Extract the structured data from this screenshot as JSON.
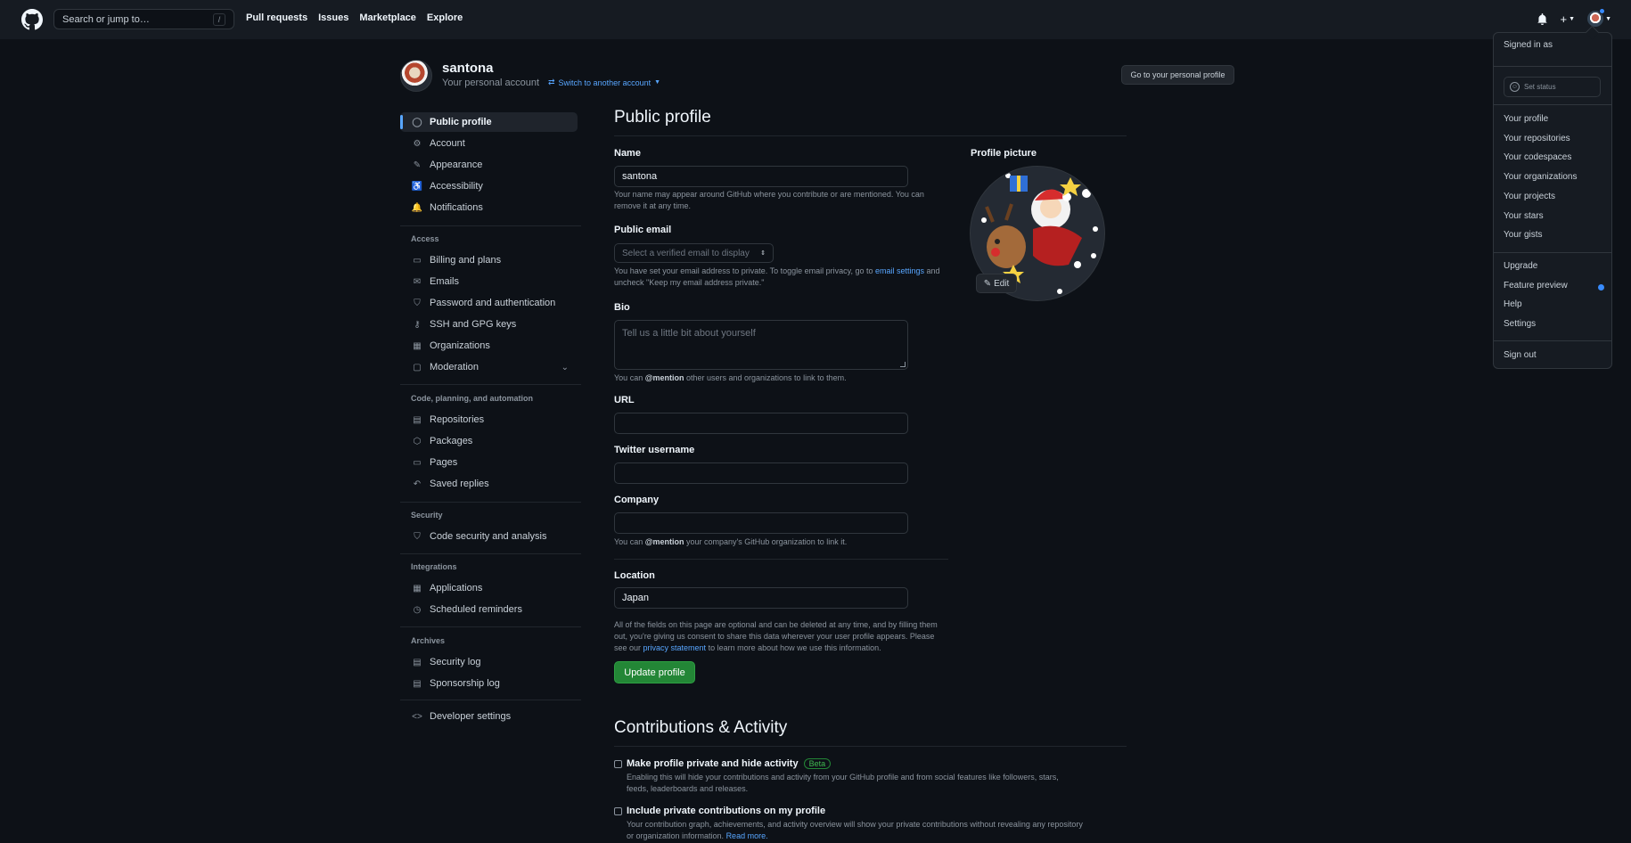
{
  "header": {
    "search_placeholder": "Search or jump to…",
    "slash_key": "/",
    "nav": [
      "Pull requests",
      "Issues",
      "Marketplace",
      "Explore"
    ]
  },
  "account": {
    "username": "santona",
    "subtitle": "Your personal account",
    "switch_label": "Switch to another account",
    "profile_button": "Go to your personal profile"
  },
  "sidebar": {
    "items_top": [
      {
        "label": "Public profile",
        "icon": "person-icon",
        "glyph": "◯"
      },
      {
        "label": "Account",
        "icon": "gear-icon",
        "glyph": "⚙"
      },
      {
        "label": "Appearance",
        "icon": "paintbrush-icon",
        "glyph": "✎"
      },
      {
        "label": "Accessibility",
        "icon": "accessibility-icon",
        "glyph": "♿"
      },
      {
        "label": "Notifications",
        "icon": "bell-icon",
        "glyph": "🔔"
      }
    ],
    "access_heading": "Access",
    "access_items": [
      {
        "label": "Billing and plans",
        "icon": "credit-card-icon",
        "glyph": "▭"
      },
      {
        "label": "Emails",
        "icon": "mail-icon",
        "glyph": "✉"
      },
      {
        "label": "Password and authentication",
        "icon": "shield-lock-icon",
        "glyph": "⛉"
      },
      {
        "label": "SSH and GPG keys",
        "icon": "key-icon",
        "glyph": "⚷"
      },
      {
        "label": "Organizations",
        "icon": "organization-icon",
        "glyph": "▦"
      },
      {
        "label": "Moderation",
        "icon": "report-icon",
        "glyph": "▢"
      }
    ],
    "code_heading": "Code, planning, and automation",
    "code_items": [
      {
        "label": "Repositories",
        "icon": "repo-icon",
        "glyph": "▤"
      },
      {
        "label": "Packages",
        "icon": "package-icon",
        "glyph": "⬡"
      },
      {
        "label": "Pages",
        "icon": "browser-icon",
        "glyph": "▭"
      },
      {
        "label": "Saved replies",
        "icon": "reply-icon",
        "glyph": "↶"
      }
    ],
    "security_heading": "Security",
    "security_items": [
      {
        "label": "Code security and analysis",
        "icon": "shield-icon",
        "glyph": "⛉"
      }
    ],
    "integrations_heading": "Integrations",
    "integrations_items": [
      {
        "label": "Applications",
        "icon": "apps-icon",
        "glyph": "▦"
      },
      {
        "label": "Scheduled reminders",
        "icon": "clock-icon",
        "glyph": "◷"
      }
    ],
    "archives_heading": "Archives",
    "archives_items": [
      {
        "label": "Security log",
        "icon": "log-icon",
        "glyph": "▤"
      },
      {
        "label": "Sponsorship log",
        "icon": "log-icon",
        "glyph": "▤"
      }
    ],
    "developer_settings": {
      "label": "Developer settings",
      "icon": "code-icon",
      "glyph": "<>"
    }
  },
  "main": {
    "title": "Public profile",
    "name_label": "Name",
    "name_value": "santona",
    "name_note": "Your name may appear around GitHub where you contribute or are mentioned. You can remove it at any time.",
    "email_label": "Public email",
    "email_select": "Select a verified email to display",
    "email_note_1": "You have set your email address to private. To toggle email privacy, go to ",
    "email_note_link": "email settings",
    "email_note_2": " and uncheck \"Keep my email address private.\"",
    "bio_label": "Bio",
    "bio_placeholder": "Tell us a little bit about yourself",
    "bio_note_1": "You can ",
    "bio_note_mention": "@mention",
    "bio_note_2": " other users and organizations to link to them.",
    "url_label": "URL",
    "url_value": "",
    "twitter_label": "Twitter username",
    "twitter_value": "",
    "company_label": "Company",
    "company_value": "",
    "company_note_1": "You can ",
    "company_note_mention": "@mention",
    "company_note_2": " your company's GitHub organization to link it.",
    "location_label": "Location",
    "location_value": "Japan",
    "footer_note_1": "All of the fields on this page are optional and can be deleted at any time, and by filling them out, you're giving us consent to share this data wherever your user profile appears. Please see our ",
    "footer_note_link": "privacy statement",
    "footer_note_2": " to learn more about how we use this information.",
    "update_button": "Update profile",
    "picture_label": "Profile picture",
    "edit_button": "Edit"
  },
  "contributions": {
    "title": "Contributions & Activity",
    "private_title": "Make profile private and hide activity",
    "private_badge": "Beta",
    "private_desc": "Enabling this will hide your contributions and activity from your GitHub profile and from social features like followers, stars, feeds, leaderboards and releases.",
    "include_title": "Include private contributions on my profile",
    "include_desc": "Your contribution graph, achievements, and activity overview will show your private contributions without revealing any repository or organization information. ",
    "include_link": "Read more."
  },
  "dropdown": {
    "signed_in": "Signed in as",
    "set_status": "Set status",
    "group1": [
      "Your profile",
      "Your repositories",
      "Your codespaces",
      "Your organizations",
      "Your projects",
      "Your stars",
      "Your gists"
    ],
    "group2": [
      "Upgrade",
      "Feature preview",
      "Help",
      "Settings"
    ],
    "sign_out": "Sign out"
  },
  "colors": {
    "accent": "#58a6ff",
    "success": "#238636",
    "bg": "#0d1117",
    "header": "#161b22"
  }
}
